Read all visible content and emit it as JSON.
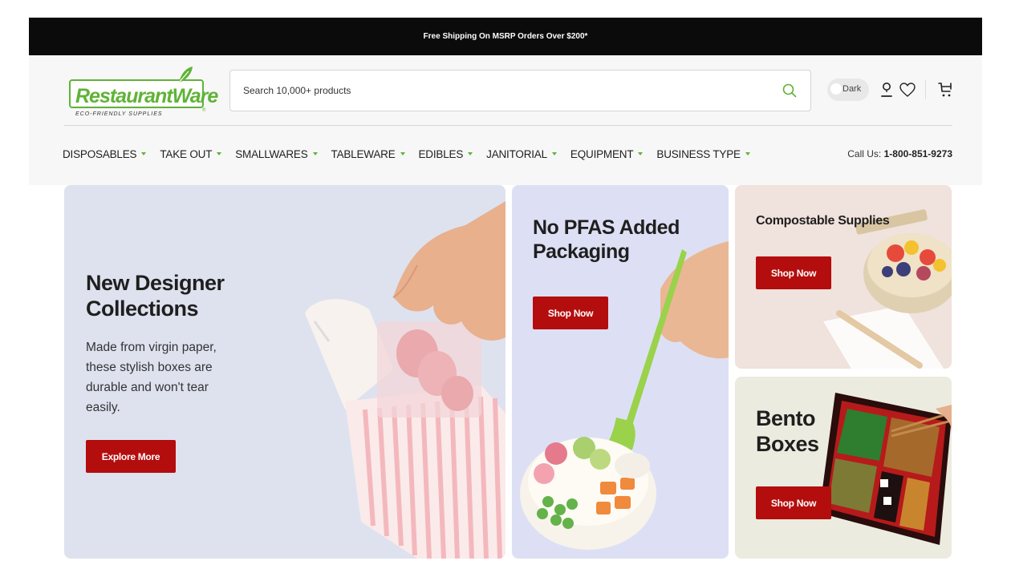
{
  "announcement": {
    "text": "Free Shipping On MSRP Orders Over $200*"
  },
  "logo": {
    "brand": "RestaurantWare",
    "tagline": "ECO-FRIENDLY SUPPLIES",
    "registered": "®"
  },
  "search": {
    "placeholder": "Search 10,000+ products",
    "value": ""
  },
  "header_actions": {
    "dark_label": "Dark",
    "icons": [
      "search-icon",
      "user-icon",
      "heart-icon",
      "cart-icon"
    ]
  },
  "nav": {
    "items": [
      {
        "label": "DISPOSABLES"
      },
      {
        "label": "TAKE OUT"
      },
      {
        "label": "SMALLWARES"
      },
      {
        "label": "TABLEWARE"
      },
      {
        "label": "EDIBLES"
      },
      {
        "label": "JANITORIAL"
      },
      {
        "label": "EQUIPMENT"
      },
      {
        "label": "BUSINESS TYPE"
      }
    ],
    "call_label": "Call Us:",
    "call_number": "1-800-851-9273"
  },
  "hero": {
    "main": {
      "title_line1": "New Designer",
      "title_line2": "Collections",
      "desc_line1": "Made from virgin paper,",
      "desc_line2": "these stylish boxes are",
      "desc_line3": "durable and won't tear",
      "desc_line4": "easily.",
      "cta": "Explore More"
    },
    "pfas": {
      "title_line1": "No PFAS Added",
      "title_line2": "Packaging",
      "cta": "Shop Now"
    },
    "compostable": {
      "title": "Compostable Supplies",
      "cta": "Shop Now"
    },
    "bento": {
      "title_line1": "Bento",
      "title_line2": "Boxes",
      "cta": "Shop Now"
    }
  },
  "colors": {
    "accent_green": "#5fb336",
    "cta_red": "#b40d0d",
    "announce_bg": "#0b0b0b"
  }
}
